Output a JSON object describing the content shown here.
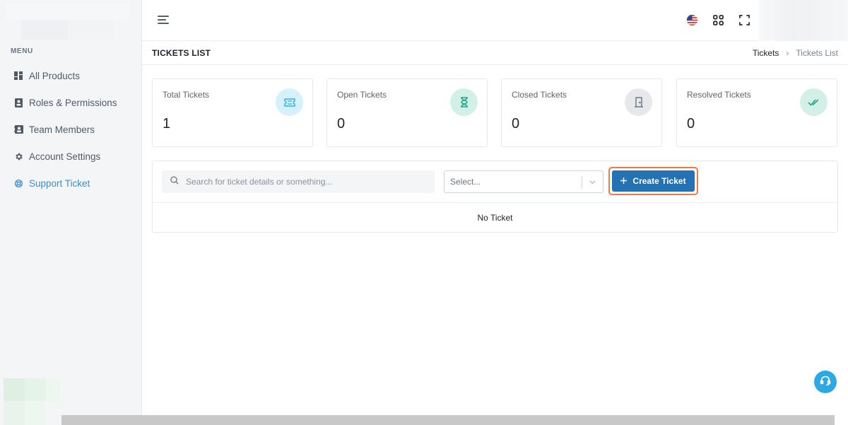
{
  "sidebar": {
    "menu_heading": "MENU",
    "items": [
      {
        "label": "All Products",
        "icon": "dashboard-grid-icon"
      },
      {
        "label": "Roles & Permissions",
        "icon": "id-badge-icon"
      },
      {
        "label": "Team Members",
        "icon": "contacts-book-icon"
      },
      {
        "label": "Account Settings",
        "icon": "gear-icon"
      },
      {
        "label": "Support Ticket",
        "icon": "lifebuoy-icon",
        "active": true
      }
    ]
  },
  "header": {
    "icons": [
      "hamburger-menu-icon",
      "us-flag-icon",
      "apps-grid-icon",
      "fullscreen-icon"
    ]
  },
  "page": {
    "title": "TICKETS LIST",
    "breadcrumb": {
      "parent": "Tickets",
      "separator": "›",
      "current": "Tickets List"
    }
  },
  "stats": [
    {
      "label": "Total Tickets",
      "value": "1",
      "icon": "ticket-icon",
      "color": "#2bb3e6",
      "bg": "#d6f1fb"
    },
    {
      "label": "Open Tickets",
      "value": "0",
      "icon": "hourglass-icon",
      "color": "#1ba486",
      "bg": "#d2f0e8"
    },
    {
      "label": "Closed Tickets",
      "value": "0",
      "icon": "door-icon",
      "color": "#6c7581",
      "bg": "#e6e8eb"
    },
    {
      "label": "Resolved Tickets",
      "value": "0",
      "icon": "double-check-icon",
      "color": "#1ba486",
      "bg": "#d2f0e8"
    }
  ],
  "tickets": {
    "search_placeholder": "Search for ticket details or something...",
    "select_placeholder": "Select...",
    "create_label": "Create Ticket",
    "empty_message": "No Ticket"
  },
  "colors": {
    "accent": "#2373b4",
    "active_nav": "#3a8ed0",
    "highlight": "#f07a3c"
  }
}
